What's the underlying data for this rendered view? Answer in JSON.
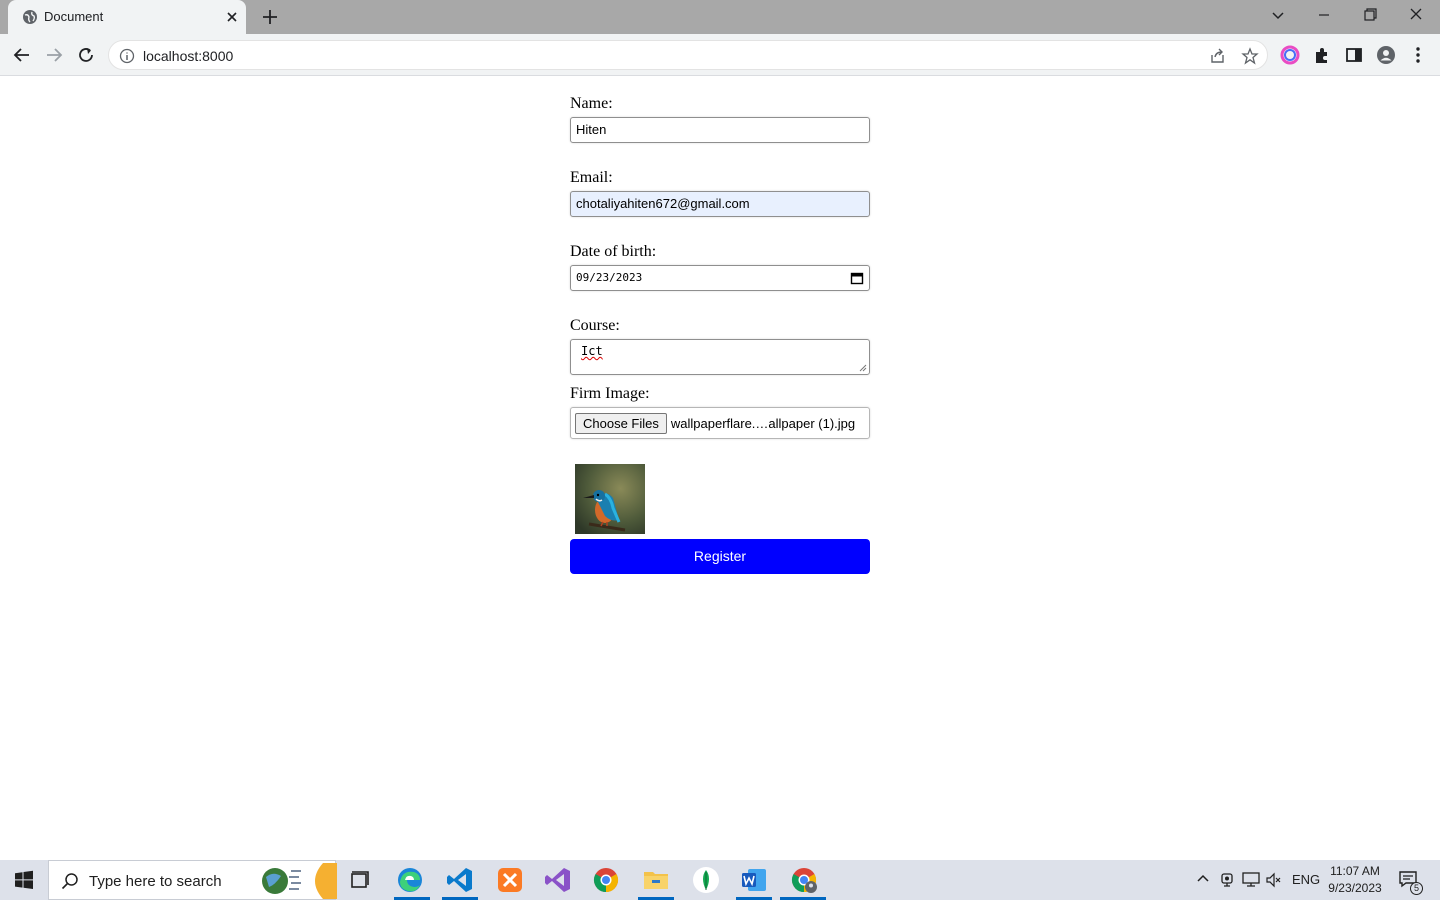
{
  "browser": {
    "tab_title": "Document",
    "url": "localhost:8000"
  },
  "form": {
    "name_label": "Name:",
    "name_value": "Hiten",
    "email_label": "Email:",
    "email_value": "chotaliyahiten672@gmail.com",
    "dob_label": "Date of birth:",
    "dob_value": "09/23/2023",
    "course_label": "Course:",
    "course_value": "Ict",
    "image_label": "Firm Image:",
    "choose_files_label": "Choose Files",
    "file_name": "wallpaperflare.…allpaper (1).jpg",
    "register_label": "Register",
    "register_color": "#0000ff"
  },
  "taskbar": {
    "search_placeholder": "Type here to search",
    "apps": [
      "task-view",
      "edge",
      "vscode",
      "xampp",
      "visual-studio",
      "chrome",
      "file-explorer",
      "mongodb-compass",
      "word",
      "chrome-profile"
    ],
    "tray_language": "ENG",
    "time": "11:07 AM",
    "date": "9/23/2023",
    "notification_count": "5"
  }
}
